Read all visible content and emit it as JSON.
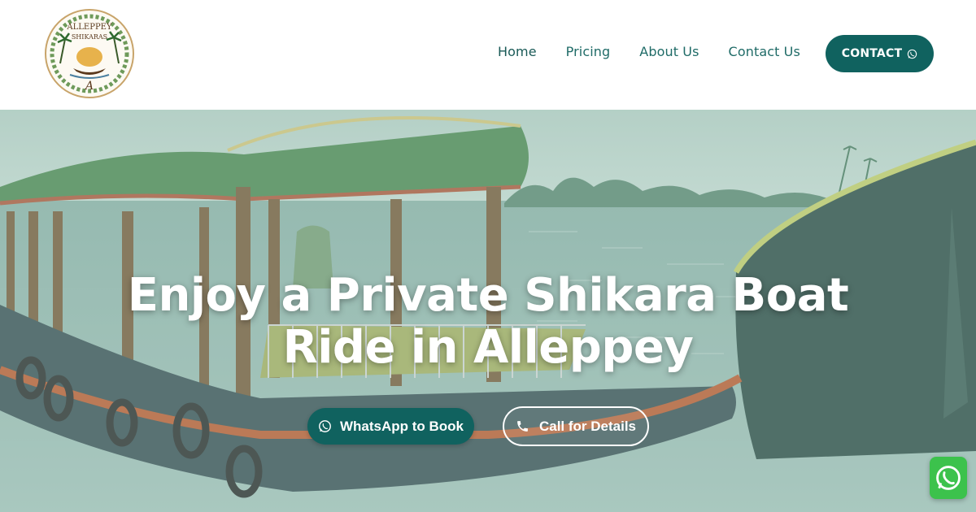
{
  "header": {
    "logo": {
      "text_top": "ALLEPPEY",
      "text_bottom": "SHIKARAS",
      "monogram": "A"
    },
    "nav": [
      {
        "label": "Home",
        "active": true
      },
      {
        "label": "Pricing",
        "active": false
      },
      {
        "label": "About Us",
        "active": false
      },
      {
        "label": "Contact Us",
        "active": false
      }
    ],
    "contact_button": {
      "label": "CONTACT",
      "icon": "whatsapp-icon"
    }
  },
  "hero": {
    "title": "Enjoy a Private Shikara Boat Ride in Alleppey",
    "buttons": {
      "whatsapp": {
        "label": "WhatsApp to Book",
        "icon": "whatsapp-icon"
      },
      "call": {
        "label": "Call for Details",
        "icon": "phone-icon"
      }
    }
  },
  "floating": {
    "icon": "whatsapp-icon"
  },
  "colors": {
    "brand": "#10625f",
    "nav_text": "#1f6b67",
    "whatsapp_green": "#3cc24c"
  }
}
